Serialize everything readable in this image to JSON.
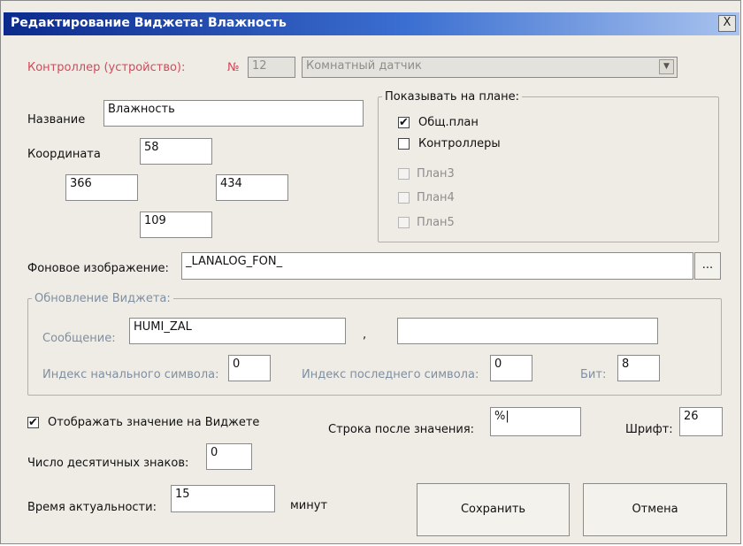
{
  "window": {
    "title": "Редактирование Виджета: Влажность",
    "close_label": "X"
  },
  "controller": {
    "label": "Контроллер (устройство):",
    "number_label": "№",
    "number_value": "12",
    "device_value": "Комнатный датчик"
  },
  "name": {
    "label": "Название",
    "value": "Влажность"
  },
  "coordinates": {
    "label": "Координата",
    "top": "58",
    "left": "366",
    "right": "434",
    "bottom": "109"
  },
  "show_on_plan": {
    "legend": "Показывать на плане:",
    "items": [
      {
        "label": "Общ.план",
        "checked": true,
        "enabled": true
      },
      {
        "label": "Контроллеры",
        "checked": false,
        "enabled": true
      },
      {
        "label": "План3",
        "checked": false,
        "enabled": false
      },
      {
        "label": "План4",
        "checked": false,
        "enabled": false
      },
      {
        "label": "План5",
        "checked": false,
        "enabled": false
      }
    ]
  },
  "background": {
    "label": "Фоновое изображение:",
    "value": "_LANALOG_FON_",
    "browse_label": "..."
  },
  "update": {
    "legend": "Обновление Виджета:",
    "message_label": "Сообщение:",
    "message_value": "HUMI_ZAL",
    "separator": ",",
    "message2_value": "",
    "start_index_label": "Индекс начального символа:",
    "start_index_value": "0",
    "end_index_label": "Индекс последнего символа:",
    "end_index_value": "0",
    "bit_label": "Бит:",
    "bit_value": "8"
  },
  "display": {
    "show_value_label": "Отображать значение на Виджете",
    "show_value_checked": true,
    "suffix_label": "Строка после значения:",
    "suffix_value": "%|",
    "font_label": "Шрифт:",
    "font_value": "26",
    "decimals_label": "Число десятичных знаков:",
    "decimals_value": "0",
    "actual_label": "Время актуальности:",
    "actual_value": "15",
    "actual_unit": "минут"
  },
  "buttons": {
    "save": "Сохранить",
    "cancel": "Отмена"
  },
  "icons": {
    "check": "✔",
    "browse": "...",
    "dropdown": "chevron-down-icon"
  }
}
